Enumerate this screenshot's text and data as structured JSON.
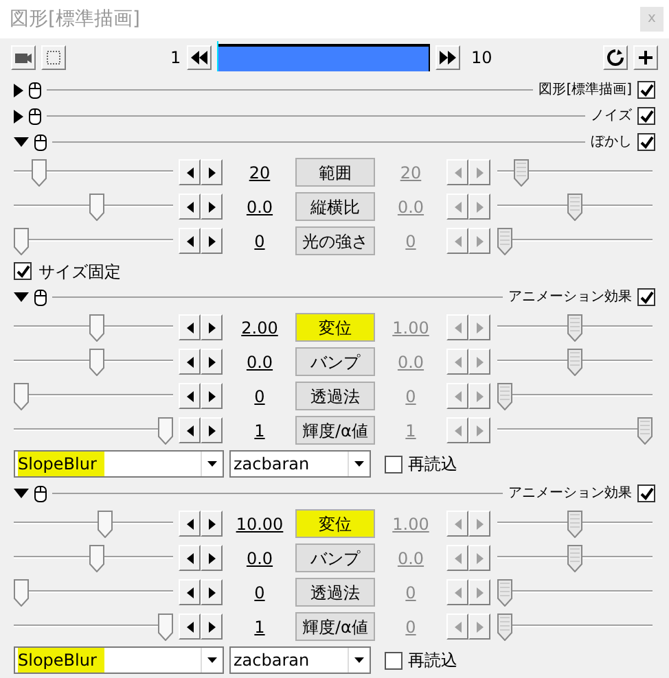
{
  "window": {
    "title": "図形[標準描画]",
    "close": "x"
  },
  "toolbar": {
    "start": "1",
    "end": "10"
  },
  "filters": [
    {
      "label": "図形[標準描画]",
      "expanded": false,
      "enabled": true
    },
    {
      "label": "ノイズ",
      "expanded": false,
      "enabled": true
    },
    {
      "label": "ぼかし",
      "expanded": true,
      "enabled": true,
      "tracks": [
        {
          "name": "範囲",
          "start": "20",
          "end": "20",
          "start_slider": {
            "level": 0.12
          },
          "end_slider": {
            "level": 0.12
          },
          "highlighted": false,
          "end_enabled": false
        },
        {
          "name": "縦横比",
          "start": "0.0",
          "end": "0.0",
          "start_slider": {
            "level": 0.52
          },
          "end_slider": {
            "level": 0.5
          },
          "highlighted": false,
          "end_enabled": false
        },
        {
          "name": "光の強さ",
          "start": "0",
          "end": "0",
          "start_slider": {
            "level": 0
          },
          "end_slider": {
            "level": 0
          },
          "highlighted": false,
          "end_enabled": false
        }
      ],
      "options": [
        {
          "label": "サイズ固定",
          "checked": true
        }
      ]
    },
    {
      "label": "アニメーション効果",
      "expanded": true,
      "enabled": true,
      "tracks": [
        {
          "name": "変位",
          "start": "2.00",
          "end": "1.00",
          "start_slider": {
            "level": 0.52
          },
          "end_slider": {
            "level": 0.5
          },
          "highlighted": true,
          "end_enabled": false
        },
        {
          "name": "バンプ",
          "start": "0.0",
          "end": "0.0",
          "start_slider": {
            "level": 0.52
          },
          "end_slider": {
            "level": 0.5
          },
          "highlighted": false,
          "end_enabled": false
        },
        {
          "name": "透過法",
          "start": "0",
          "end": "0",
          "start_slider": {
            "level": 0
          },
          "end_slider": {
            "level": 0
          },
          "highlighted": false,
          "end_enabled": false
        },
        {
          "name": "輝度/α値",
          "start": "1",
          "end": "1",
          "start_slider": {
            "level": 1
          },
          "end_slider": {
            "level": 1
          },
          "highlighted": false,
          "end_enabled": false
        }
      ],
      "script": {
        "name": "SlopeBlur",
        "author": "zacbaran",
        "highlighted": true,
        "reload_label": "再読込",
        "reload": false
      }
    },
    {
      "label": "アニメーション効果",
      "expanded": true,
      "enabled": true,
      "tracks": [
        {
          "name": "変位",
          "start": "10.00",
          "end": "1.00",
          "start_slider": {
            "level": 0.58
          },
          "end_slider": {
            "level": 0.5
          },
          "highlighted": true,
          "end_enabled": false
        },
        {
          "name": "バンプ",
          "start": "0.0",
          "end": "0.0",
          "start_slider": {
            "level": 0.52
          },
          "end_slider": {
            "level": 0.5
          },
          "highlighted": false,
          "end_enabled": false
        },
        {
          "name": "透過法",
          "start": "0",
          "end": "0",
          "start_slider": {
            "level": 0
          },
          "end_slider": {
            "level": 0
          },
          "highlighted": false,
          "end_enabled": false
        },
        {
          "name": "輝度/α値",
          "start": "1",
          "end": "0",
          "start_slider": {
            "level": 1
          },
          "end_slider": {
            "level": 0
          },
          "highlighted": false,
          "end_enabled": false
        }
      ],
      "script": {
        "name": "SlopeBlur",
        "author": "zacbaran",
        "highlighted": true,
        "reload_label": "再読込",
        "reload": false
      }
    }
  ]
}
